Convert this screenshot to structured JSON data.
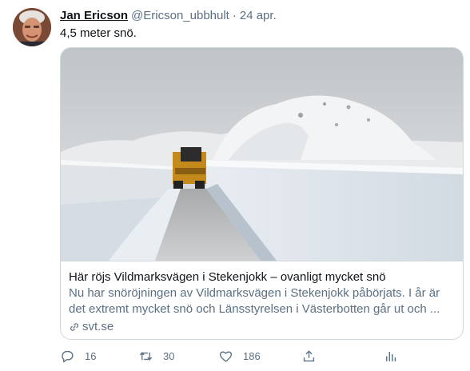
{
  "tweet": {
    "author_name": "Jan Ericson",
    "handle": "@Ericson_ubbhult",
    "separator": "·",
    "date": "24 apr.",
    "text": "4,5 meter snö."
  },
  "card": {
    "title": "Här röjs Vildmarksvägen i Stekenjokk – ovanligt mycket snö",
    "description": "Nu har snöröjningen av Vildmarksvägen i Stekenjokk påbörjats. I år är det extremt mycket snö och Länsstyrelsen i Västerbotten går ut och ...",
    "domain": "svt.se"
  },
  "actions": {
    "reply_count": "16",
    "retweet_count": "30",
    "like_count": "186"
  },
  "icons": [
    "reply-icon",
    "retweet-icon",
    "like-icon",
    "share-icon",
    "analytics-icon",
    "link-icon"
  ],
  "colors": {
    "secondary_text": "#5b7083",
    "border": "#cfd9de",
    "text": "#0f1419"
  }
}
